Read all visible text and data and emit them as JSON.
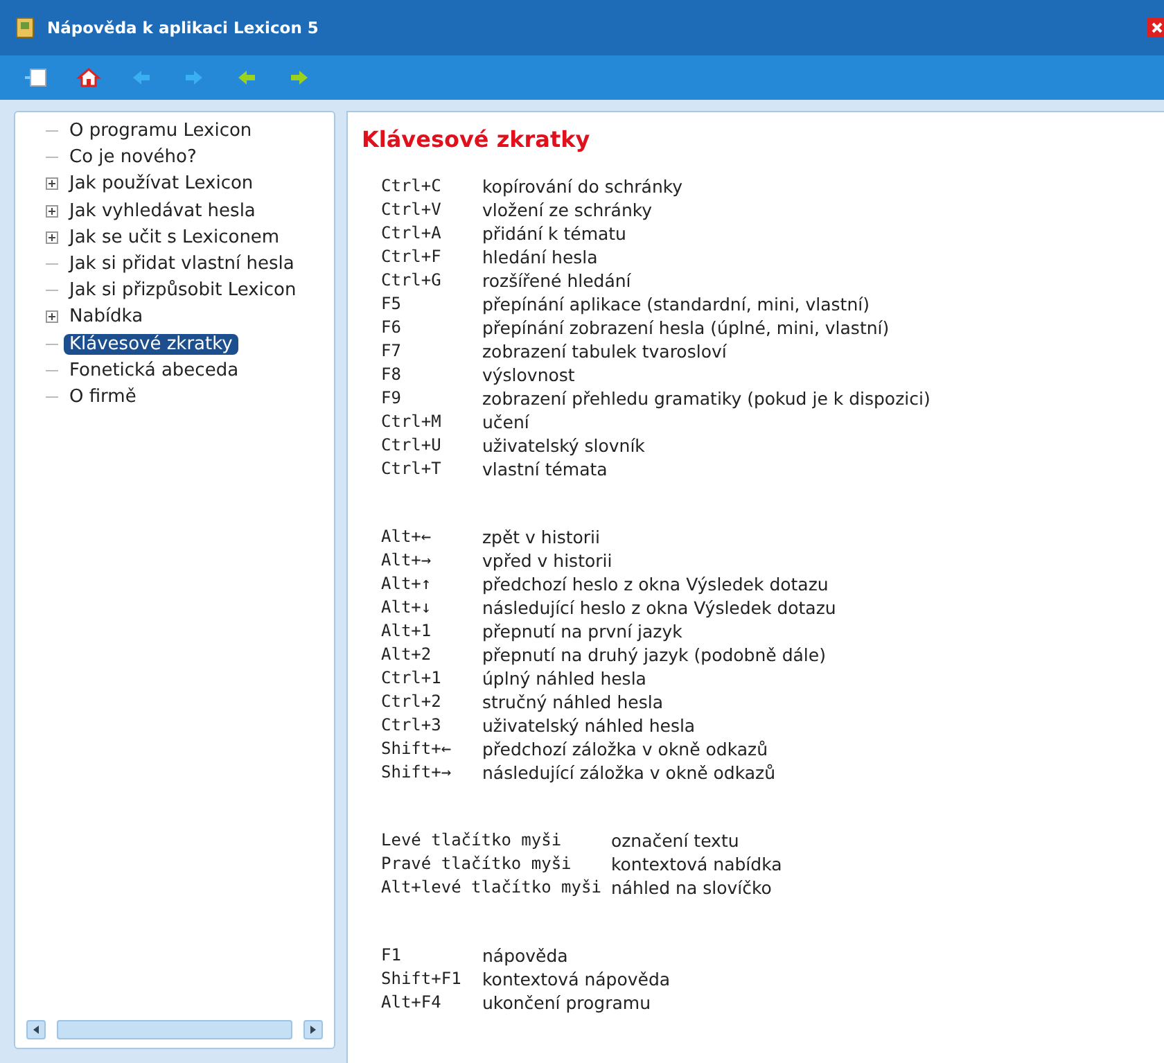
{
  "window": {
    "title": "Nápověda k aplikaci Lexicon 5"
  },
  "tree": [
    {
      "label": "O programu Lexicon",
      "expandable": false,
      "selected": false
    },
    {
      "label": "Co je nového?",
      "expandable": false,
      "selected": false
    },
    {
      "label": "Jak používat Lexicon",
      "expandable": true,
      "selected": false
    },
    {
      "label": "Jak vyhledávat hesla",
      "expandable": true,
      "selected": false
    },
    {
      "label": "Jak se učit s Lexiconem",
      "expandable": true,
      "selected": false
    },
    {
      "label": "Jak si přidat vlastní hesla",
      "expandable": false,
      "selected": false
    },
    {
      "label": "Jak si přizpůsobit Lexicon",
      "expandable": false,
      "selected": false
    },
    {
      "label": "Nabídka",
      "expandable": true,
      "selected": false
    },
    {
      "label": "Klávesové zkratky",
      "expandable": false,
      "selected": true
    },
    {
      "label": "Fonetická abeceda",
      "expandable": false,
      "selected": false
    },
    {
      "label": "O firmě",
      "expandable": false,
      "selected": false
    }
  ],
  "content": {
    "heading": "Klávesové zkratky",
    "groups": [
      {
        "rows": [
          {
            "key": "Ctrl+C",
            "action": "kopírování do schránky"
          },
          {
            "key": "Ctrl+V",
            "action": "vložení ze schránky"
          },
          {
            "key": "Ctrl+A",
            "action": "přidání k tématu"
          },
          {
            "key": "Ctrl+F",
            "action": "hledání hesla"
          },
          {
            "key": "Ctrl+G",
            "action": "rozšířené hledání"
          },
          {
            "key": "F5",
            "action": "přepínání aplikace (standardní, mini, vlastní)"
          },
          {
            "key": "F6",
            "action": "přepínání zobrazení hesla (úplné, mini, vlastní)"
          },
          {
            "key": "F7",
            "action": "zobrazení tabulek tvarosloví"
          },
          {
            "key": "F8",
            "action": "výslovnost"
          },
          {
            "key": "F9",
            "action": "zobrazení přehledu gramatiky (pokud je k dispozici)"
          },
          {
            "key": "Ctrl+M",
            "action": "učení"
          },
          {
            "key": "Ctrl+U",
            "action": "uživatelský slovník"
          },
          {
            "key": "Ctrl+T",
            "action": "vlastní témata"
          }
        ]
      },
      {
        "rows": [
          {
            "key": "Alt+←",
            "action": "zpět v historii"
          },
          {
            "key": "Alt+→",
            "action": "vpřed v historii"
          },
          {
            "key": "Alt+↑",
            "action": "předchozí heslo z okna Výsledek dotazu"
          },
          {
            "key": "Alt+↓",
            "action": "následující heslo z okna Výsledek dotazu"
          },
          {
            "key": "Alt+1",
            "action": "přepnutí na první jazyk"
          },
          {
            "key": "Alt+2",
            "action": "přepnutí na druhý jazyk (podobně dále)"
          },
          {
            "key": "Ctrl+1",
            "action": "úplný náhled hesla"
          },
          {
            "key": "Ctrl+2",
            "action": "stručný náhled hesla"
          },
          {
            "key": "Ctrl+3",
            "action": "uživatelský náhled hesla"
          },
          {
            "key": "Shift+←",
            "action": "předchozí záložka v okně odkazů"
          },
          {
            "key": "Shift+→",
            "action": "následující záložka v okně odkazů"
          }
        ]
      },
      {
        "rows": [
          {
            "key": "Levé tlačítko myši",
            "action": "označení textu"
          },
          {
            "key": "Pravé tlačítko myši",
            "action": "kontextová nabídka"
          },
          {
            "key": "Alt+levé tlačítko myši",
            "action": "náhled na slovíčko"
          }
        ]
      },
      {
        "rows": [
          {
            "key": "F1",
            "action": "nápověda"
          },
          {
            "key": "Shift+F1",
            "action": "kontextová nápověda"
          },
          {
            "key": "Alt+F4",
            "action": "ukončení programu"
          }
        ]
      }
    ]
  }
}
